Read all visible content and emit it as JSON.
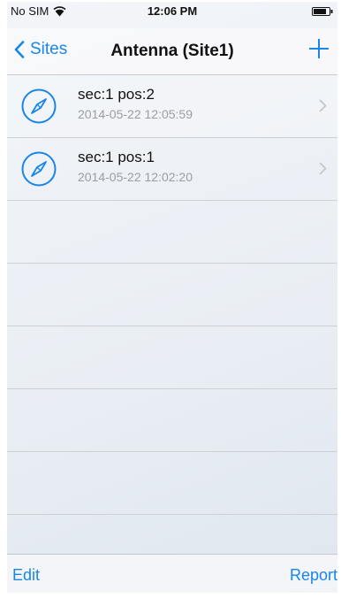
{
  "status_bar": {
    "carrier": "No SIM",
    "time": "12:06 PM",
    "wifi_icon": "wifi-icon",
    "battery_icon": "battery-icon"
  },
  "nav": {
    "back_label": "Sites",
    "title": "Antenna (Site1)",
    "add_icon": "plus-icon"
  },
  "list": {
    "items": [
      {
        "title": "sec:1  pos:2",
        "subtitle": "2014-05-22 12:05:59",
        "icon": "compass-icon"
      },
      {
        "title": "sec:1  pos:1",
        "subtitle": "2014-05-22 12:02:20",
        "icon": "compass-icon"
      }
    ]
  },
  "toolbar": {
    "left_label": "Edit",
    "right_label": "Report"
  },
  "colors": {
    "accent": "#1a86e8",
    "separator": "#cdd1d6",
    "secondary_text": "#9a9ea3"
  }
}
